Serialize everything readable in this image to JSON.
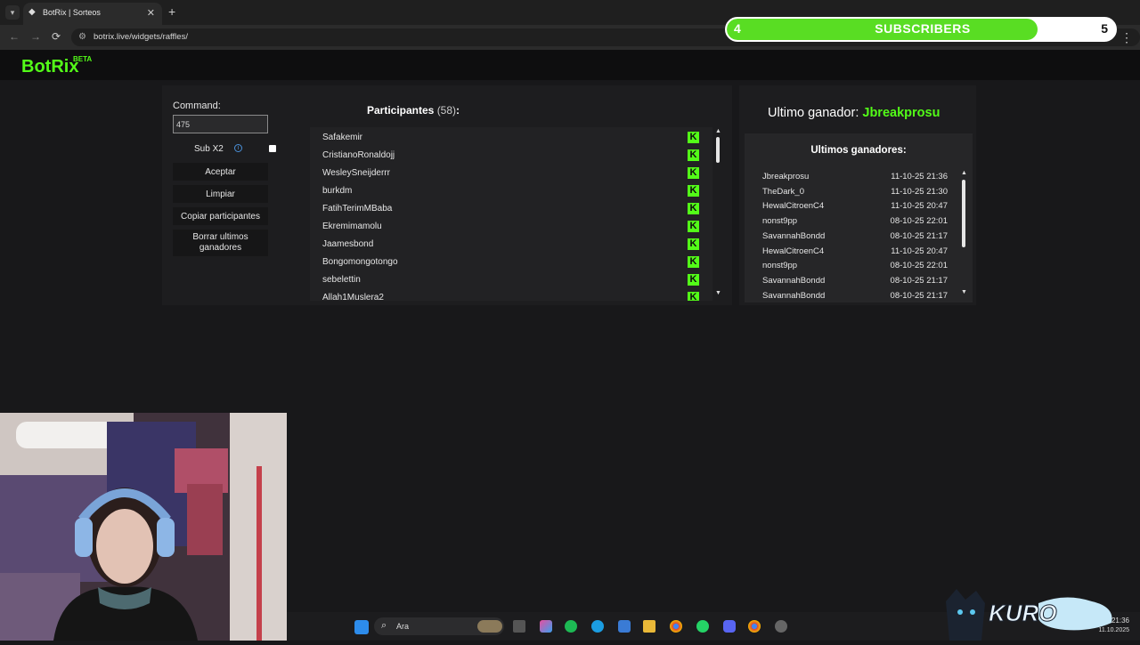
{
  "browser": {
    "tab_title": "BotRix | Sorteos",
    "tab_close": "✕",
    "new_tab": "+",
    "url": "botrix.live/widgets/raffles/",
    "nav_back": "←",
    "nav_forward": "→",
    "nav_reload": "⟳",
    "menu_dots": "⋮"
  },
  "subscriber_goal": {
    "current": "4",
    "label": "SUBSCRIBERS",
    "goal": "5",
    "progress_fraction": 0.8,
    "fill_color": "#59dd23"
  },
  "app": {
    "logo": "BotRix",
    "logo_badge": "BETA",
    "brand_color": "#53fc18"
  },
  "controls": {
    "command_label": "Command:",
    "command_value": "475",
    "subx2_label": "Sub X2",
    "subx2_checked": false,
    "buttons": {
      "accept": "Aceptar",
      "clear": "Limpiar",
      "copy": "Copiar participantes",
      "delete_last": "Borrar ultimos ganadores"
    }
  },
  "participants": {
    "title": "Participantes",
    "count": "(58)",
    "colon": ":",
    "items": [
      {
        "name": "Safakemir",
        "platform": "K"
      },
      {
        "name": "CristianoRonaldojj",
        "platform": "K"
      },
      {
        "name": "WesleySneijderrr",
        "platform": "K"
      },
      {
        "name": "burkdm",
        "platform": "K"
      },
      {
        "name": "FatihTerimMBaba",
        "platform": "K"
      },
      {
        "name": "Ekremimamolu",
        "platform": "K"
      },
      {
        "name": "Jaamesbond",
        "platform": "K"
      },
      {
        "name": "Bongomongotongo",
        "platform": "K"
      },
      {
        "name": "sebelettin",
        "platform": "K"
      },
      {
        "name": "Allah1Muslera2",
        "platform": "K"
      }
    ]
  },
  "winners": {
    "last_label": "Ultimo ganador:",
    "last_name": "Jbreakprosu",
    "list_title": "Ultimos ganadores:",
    "items": [
      {
        "name": "Jbreakprosu",
        "date": "11-10-25 21:36"
      },
      {
        "name": "TheDark_0",
        "date": "11-10-25 21:30"
      },
      {
        "name": "HewalCitroenC4",
        "date": "11-10-25 20:47"
      },
      {
        "name": "nonst9pp",
        "date": "08-10-25 22:01"
      },
      {
        "name": "SavannahBondd",
        "date": "08-10-25 21:17"
      },
      {
        "name": "HewalCitroenC4",
        "date": "11-10-25 20:47"
      },
      {
        "name": "nonst9pp",
        "date": "08-10-25 22:01"
      },
      {
        "name": "SavannahBondd",
        "date": "08-10-25 21:17"
      },
      {
        "name": "SavannahBondd",
        "date": "08-10-25 21:17"
      }
    ]
  },
  "taskbar": {
    "search_placeholder": "Ara",
    "clock": "21:36",
    "date": "11.10.2025"
  },
  "overlay": {
    "kuro_text": "KURO"
  }
}
